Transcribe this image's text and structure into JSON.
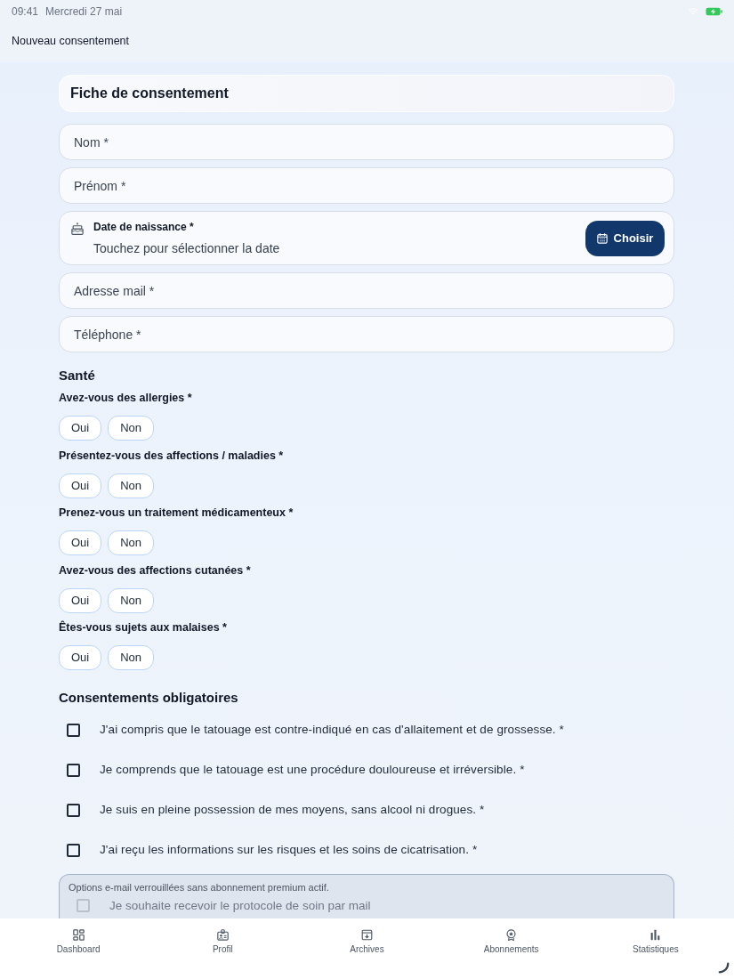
{
  "status_bar": {
    "time": "09:41",
    "date": "Mercredi 27 mai"
  },
  "header": {
    "title": "Nouveau consentement"
  },
  "form": {
    "title": "Fiche de consentement",
    "fields": [
      {
        "kind": "text",
        "placeholder": "Nom *"
      },
      {
        "kind": "text",
        "placeholder": "Prénom *"
      },
      {
        "kind": "date",
        "label": "Date de naissance *",
        "placeholder": "Touchez pour sélectionner la date",
        "button": "Choisir"
      },
      {
        "kind": "text",
        "placeholder": "Adresse mail *"
      },
      {
        "kind": "text",
        "placeholder": "Téléphone *"
      }
    ]
  },
  "health": {
    "title": "Santé",
    "questions": [
      {
        "label": "Avez-vous des allergies *",
        "options": [
          {
            "label": "Oui",
            "selected": false
          },
          {
            "label": "Non",
            "selected": false
          }
        ]
      },
      {
        "label": "Présentez-vous des affections / maladies *",
        "options": [
          {
            "label": "Oui",
            "selected": false
          },
          {
            "label": "Non",
            "selected": false
          }
        ]
      },
      {
        "label": "Prenez-vous un traitement médicamenteux *",
        "options": [
          {
            "label": "Oui",
            "selected": false
          },
          {
            "label": "Non",
            "selected": false
          }
        ]
      },
      {
        "label": "Avez-vous des affections cutanées *",
        "options": [
          {
            "label": "Oui",
            "selected": false
          },
          {
            "label": "Non",
            "selected": false
          }
        ]
      },
      {
        "label": "Êtes-vous sujets aux malaises *",
        "options": [
          {
            "label": "Oui",
            "selected": false
          },
          {
            "label": "Non",
            "selected": false
          }
        ]
      }
    ]
  },
  "consents": {
    "title": "Consentements obligatoires",
    "items": [
      {
        "label": "J'ai compris que le tatouage est contre-indiqué en cas d'allaitement et de grossesse. *",
        "checked": false
      },
      {
        "label": "Je comprends que le tatouage est une procédure douloureuse et irréversible. *",
        "checked": false
      },
      {
        "label": "Je suis en pleine possession de mes moyens, sans alcool ni drogues. *",
        "checked": false
      },
      {
        "label": "J'ai reçu les informations sur les risques et les soins de cicatrisation. *",
        "checked": false
      }
    ]
  },
  "email_options": {
    "notice": "Options e-mail verrouillées sans abonnement premium actif.",
    "items": [
      {
        "label": "Je souhaite recevoir le protocole de soin par mail",
        "checked": false,
        "disabled": true
      }
    ]
  },
  "tab_bar": [
    {
      "kind": "dashboard",
      "label": "Dashboard",
      "selected": false
    },
    {
      "kind": "profile",
      "label": "Profil",
      "selected": false
    },
    {
      "kind": "archives",
      "label": "Archives",
      "selected": false
    },
    {
      "kind": "subscriptions",
      "label": "Abonnements",
      "selected": false
    },
    {
      "kind": "stats",
      "label": "Statistiques",
      "selected": false
    }
  ]
}
